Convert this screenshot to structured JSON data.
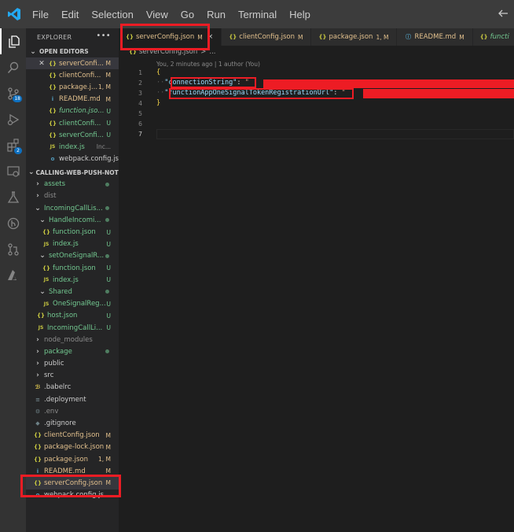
{
  "menubar": {
    "items": [
      "File",
      "Edit",
      "Selection",
      "View",
      "Go",
      "Run",
      "Terminal",
      "Help"
    ]
  },
  "activity": {
    "scm_badge": "18",
    "extensions_badge": "2"
  },
  "sidebar": {
    "title": "EXPLORER",
    "open_editors_title": "OPEN EDITORS",
    "open_editors": [
      {
        "name": "serverConfi...",
        "status": "M",
        "icon": "{}"
      },
      {
        "name": "clientConfi...",
        "status": "M",
        "icon": "{}"
      },
      {
        "name": "package.j...",
        "status": "1, M",
        "icon": "{}"
      },
      {
        "name": "README.md",
        "status": "M",
        "icon": "i"
      },
      {
        "name": "function.jso...",
        "status": "U",
        "icon": "{}"
      },
      {
        "name": "clientConfi...",
        "status": "U",
        "icon": "{}"
      },
      {
        "name": "serverConfi...",
        "status": "U",
        "icon": "{}"
      },
      {
        "name": "index.js",
        "status": "Inc...",
        "icon": "JS"
      },
      {
        "name": "webpack.config.js",
        "status": "",
        "icon": "o"
      }
    ],
    "project_title": "CALLING-WEB-PUSH-NOTI...",
    "tree": [
      {
        "name": "assets",
        "status": ""
      },
      {
        "name": "dist",
        "status": ""
      },
      {
        "name": "IncomingCallLis...",
        "status": ""
      },
      {
        "name": "HandleIncomi...",
        "status": ""
      },
      {
        "name": "function.json",
        "status": "U"
      },
      {
        "name": "index.js",
        "status": "U"
      },
      {
        "name": "setOneSignalR...",
        "status": ""
      },
      {
        "name": "function.json",
        "status": "U"
      },
      {
        "name": "index.js",
        "status": "U"
      },
      {
        "name": "Shared",
        "status": ""
      },
      {
        "name": "OneSignalReg...",
        "status": "U"
      },
      {
        "name": "host.json",
        "status": "U"
      },
      {
        "name": "IncomingCallLi...",
        "status": "U"
      },
      {
        "name": "node_modules",
        "status": ""
      },
      {
        "name": "package",
        "status": ""
      },
      {
        "name": "public",
        "status": ""
      },
      {
        "name": "src",
        "status": ""
      },
      {
        "name": ".babelrc",
        "status": ""
      },
      {
        "name": ".deployment",
        "status": ""
      },
      {
        "name": ".env",
        "status": ""
      },
      {
        "name": ".gitignore",
        "status": ""
      },
      {
        "name": "clientConfig.json",
        "status": "M"
      },
      {
        "name": "package-lock.json",
        "status": "M"
      },
      {
        "name": "package.json",
        "status": "1, M"
      },
      {
        "name": "README.md",
        "status": "M"
      },
      {
        "name": "serverConfig.json",
        "status": "M"
      },
      {
        "name": "webpack.config.js",
        "status": ""
      }
    ]
  },
  "tabs": [
    {
      "label": "serverConfig.json",
      "status": "M",
      "close": "×"
    },
    {
      "label": "clientConfig.json",
      "status": "M"
    },
    {
      "label": "package.json",
      "status": "1, M"
    },
    {
      "label": "README.md",
      "status": "M"
    },
    {
      "label": "functi",
      "status": ""
    }
  ],
  "breadcrumb": {
    "file": "serverConfig.json",
    "sep": ">",
    "more": "..."
  },
  "editor": {
    "blame": "You, 2 minutes ago | 1 author (You)",
    "line_numbers": [
      "1",
      "2",
      "3",
      "4",
      "5",
      "6",
      "7"
    ],
    "lines": {
      "l1": "{",
      "l2_key": "\"connectionString\"",
      "l2_colon": ": ",
      "l2_val": "\"",
      "l3_key": "\"functionAppOneSignalTokenRegistrationUrl\"",
      "l3_colon": ": ",
      "l3_val": "\"",
      "l4": "}"
    }
  },
  "colors": {
    "highlight": "#ed1c24",
    "accent": "#007acc",
    "modified": "#e2c08d",
    "untracked": "#73c991"
  }
}
